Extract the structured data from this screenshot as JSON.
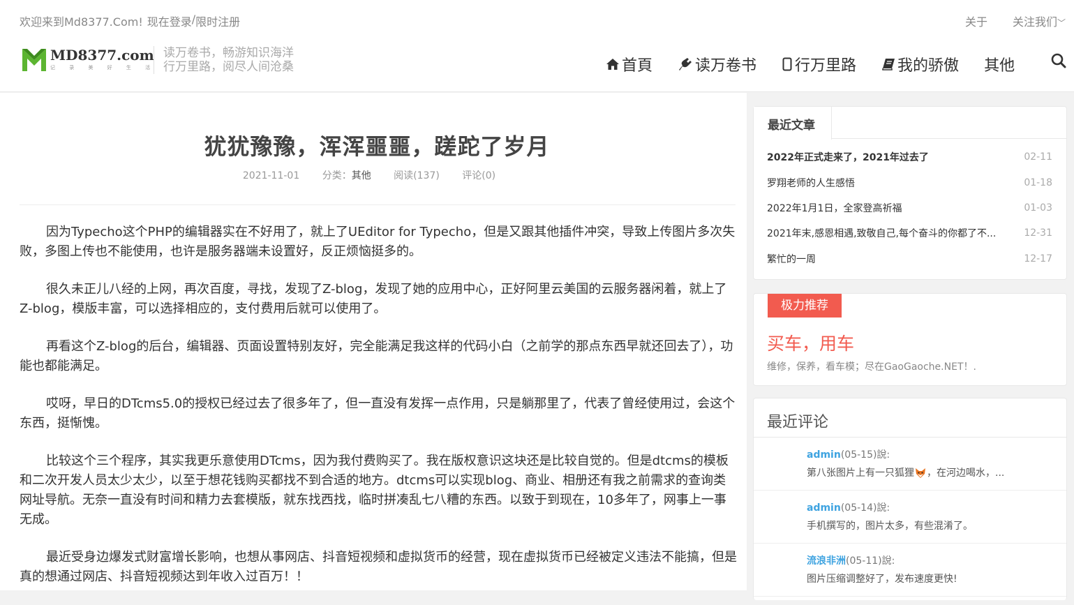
{
  "topbar": {
    "welcome": "欢迎来到Md8377.Com!",
    "login": "现在登录",
    "sep": "/",
    "register": "限时注册",
    "about": "关于",
    "follow": "关注我们"
  },
  "logo": {
    "brand": "MD8377.com",
    "tagline": "记 录 美 好 生 活"
  },
  "slogan": {
    "line1": "读万卷书，畅游知识海洋",
    "line2": "行万里路，阅尽人间沧桑"
  },
  "nav": [
    {
      "label": "首頁",
      "icon": "home-icon"
    },
    {
      "label": "读万卷书",
      "icon": "plug-icon"
    },
    {
      "label": "行万里路",
      "icon": "mobile-icon"
    },
    {
      "label": "我的骄傲",
      "icon": "book-icon"
    },
    {
      "label": "其他",
      "icon": ""
    }
  ],
  "post": {
    "title": "犹犹豫豫，浑浑噩噩，蹉跎了岁月",
    "date": "2021-11-01",
    "category_label": "分类：",
    "category": "其他",
    "views": "阅读(137)",
    "comments": "评论(0)",
    "paragraphs": [
      "因为Typecho这个PHP的编辑器实在不好用了，就上了UEditor for Typecho，但是又跟其他插件冲突，导致上传图片多次失败，多图上传也不能使用，也许是服务器端未设置好，反正烦恼挺多的。",
      "很久未正儿八经的上网，再次百度，寻找，发现了Z-blog，发现了她的应用中心，正好阿里云美国的云服务器闲着，就上了Z-blog，模版丰富，可以选择相应的，支付费用后就可以使用了。",
      "再看这个Z-blog的后台，编辑器、页面设置特别友好，完全能满足我这样的代码小白（之前学的那点东西早就还回去了），功能也都能满足。",
      "哎呀，早日的DTcms5.0的授权已经过去了很多年了，但一直没有发挥一点作用，只是躺那里了，代表了曾经使用过，会这个东西，挺惭愧。",
      "比较这个三个程序，其实我更乐意使用DTcms，因为我付费购买了。我在版权意识这块还是比较自觉的。但是dtcms的模板和二次开发人员太少太少，以至于想花钱购买都找不到合适的地方。dtcms可以实现blog、商业、相册还有我之前需求的查询类网址导航。无奈一直没有时间和精力去套模版，就东找西找，临时拼凑乱七八糟的东西。以致于到现在，10多年了，网事上一事无成。",
      "最近受身边爆发式财富增长影响，也想从事网店、抖音短视频和虚拟货币的经营，现在虚拟货币已经被定义违法不能搞，但是真的想通过网店、抖音短视频达到年收入过百万！！"
    ]
  },
  "recent": {
    "tab": "最近文章",
    "items": [
      {
        "title": "2022年正式走来了，2021年过去了",
        "date": "02-11"
      },
      {
        "title": "罗翔老师的人生感悟",
        "date": "01-18"
      },
      {
        "title": "2022年1月1日，全家登高祈福",
        "date": "01-03"
      },
      {
        "title": "2021年末,感恩相遇,致敬自己,每个奋斗的你都了不...",
        "date": "12-31"
      },
      {
        "title": "繁忙的一周",
        "date": "12-17"
      }
    ]
  },
  "recommend": {
    "badge": "极力推荐",
    "title": "买车，用车",
    "desc": "维修，保养，看车模；尽在GaoGaoche.NET！."
  },
  "comments": {
    "title": "最近评论",
    "items": [
      {
        "user": "admin",
        "meta": "(05-15)說:",
        "text_before": "第八张图片上有一只狐狸",
        "text_after": "，在河边喝水，..."
      },
      {
        "user": "admin",
        "meta": "(05-14)說:",
        "text_before": "手机撰写的，图片太多，有些混淆了。",
        "text_after": ""
      },
      {
        "user": "流浪非洲",
        "meta": "(05-11)說:",
        "text_before": "图片压缩调整好了，发布速度更快!",
        "text_after": ""
      }
    ]
  },
  "colors": {
    "accent": "#f25b4f",
    "link": "#3ea3e0",
    "logo_green": "#5cb531"
  }
}
